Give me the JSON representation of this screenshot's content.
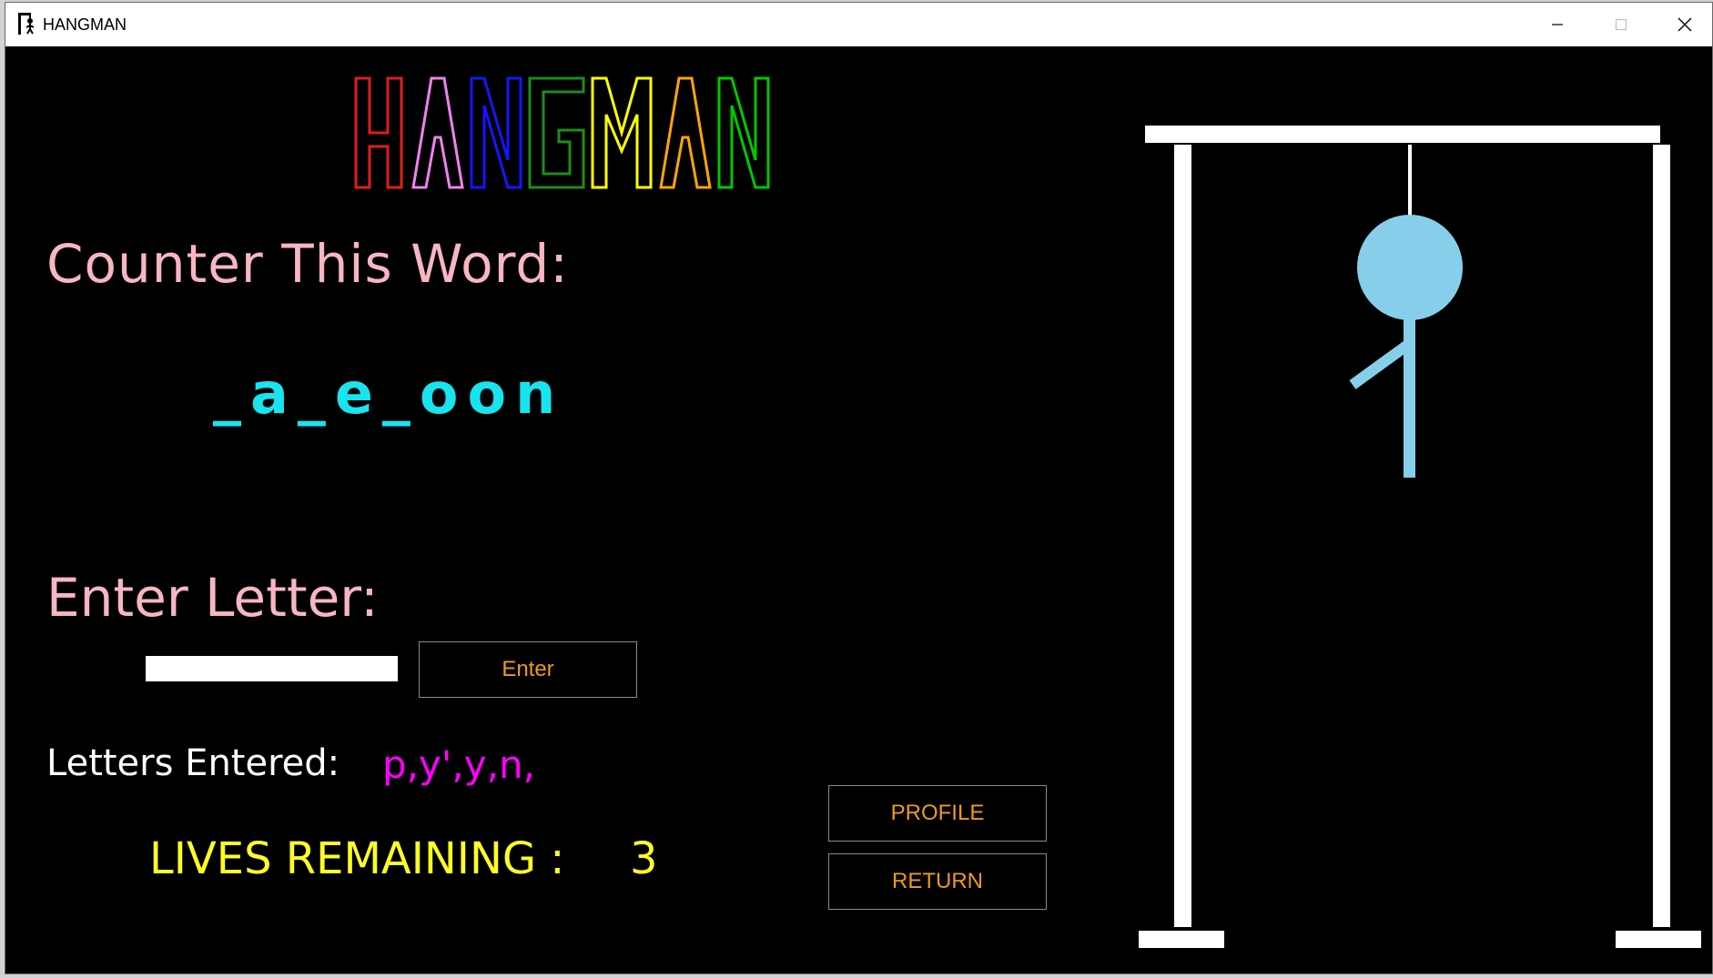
{
  "window": {
    "title": "HANGMAN",
    "icon": "hangman-app-icon"
  },
  "logo": {
    "text": "HANGMAN",
    "letter_colors": [
      "#e01c1c",
      "#ee82ee",
      "#1515ff",
      "#1e8c1e",
      "#ffff00",
      "#ffff00",
      "#ffa500",
      "#00c800"
    ]
  },
  "game": {
    "counter_label": "Counter This Word:",
    "word_display": "_a_e_oon",
    "enter_label": "Enter Letter:",
    "input_value": "",
    "enter_button": "Enter",
    "letters_entered_label": "Letters Entered:",
    "letters_entered_value": "p,y',y,n,",
    "lives_label": "LIVES REMAINING :",
    "lives_value": "3",
    "profile_button": "PROFILE",
    "return_button": "RETURN"
  },
  "colors": {
    "background": "#000000",
    "label_pink": "#f7b6c2",
    "word_cyan": "#18e4ef",
    "letters_magenta": "#ff00ff",
    "lives_yellow": "#ffff24",
    "button_text_orange": "#ec9a1d",
    "figure_blue": "#87ceeb",
    "gallows_white": "#ffffff"
  },
  "hangman_figure": {
    "parts_shown": [
      "head",
      "body",
      "left-arm"
    ]
  }
}
